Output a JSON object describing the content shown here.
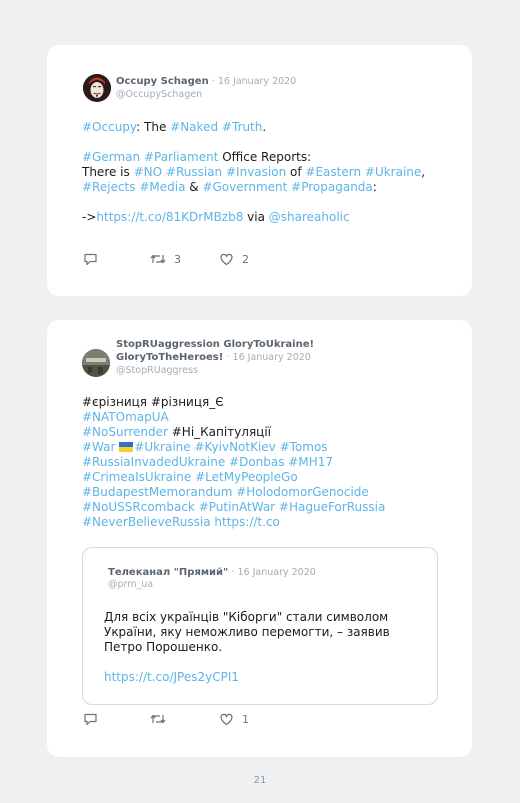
{
  "tweet1": {
    "display_name": "Occupy Schagen",
    "date": "· 16 January 2020",
    "handle": "@OccupySchagen",
    "line1": {
      "t1": "#Occupy",
      "t2": ": The ",
      "t3": "#Naked",
      "t4": " ",
      "t5": "#Truth",
      "t6": "."
    },
    "line2": {
      "t1": "#German",
      "t2": " ",
      "t3": "#Parliament",
      "t4": " Office Reports:"
    },
    "line3": {
      "t1": "There is ",
      "t2": "#NO",
      "t3": " ",
      "t4": "#Russian",
      "t5": " ",
      "t6": "#Invasion",
      "t7": " of ",
      "t8": "#Eastern",
      "t9": " ",
      "t10": "#Ukraine",
      "t11": ","
    },
    "line4": {
      "t1": "#Rejects",
      "t2": " ",
      "t3": "#Media",
      "t4": " & ",
      "t5": "#Government",
      "t6": " ",
      "t7": "#Propaganda",
      "t8": ":"
    },
    "line5": {
      "t1": "->",
      "t2": "https://t.co/81KDrMBzb8",
      "t3": " via ",
      "t4": "@shareaholic"
    },
    "retweets": "3",
    "likes": "2"
  },
  "tweet2": {
    "display_name_line1": "StopRUaggression GloryToUkraine!",
    "display_name_line2": "GloryToTheHeroes!",
    "date": "· 16 January 2020",
    "handle": "@StopRUaggress",
    "lines": {
      "l1": "#єрізниця #різниця_Є",
      "l2": "#NATOmapUA",
      "l3a": "#NoSurrender",
      "l3b": " #Ні_Капітуляції",
      "l4a": "#War ",
      "l4b": "#Ukraine #KyivNotKiev #Tomos",
      "l5": "#RussiaInvadedUkraine #Donbas #MH17",
      "l6": "#CrimeaIsUkraine #LetMyPeopleGo",
      "l7": "#BudapestMemorandum #HolodomorGenocide",
      "l8": "#NoUSSRcomback #PutinAtWar #HagueForRussia",
      "l9": "#NeverBelieveRussia https://t.co"
    },
    "quote": {
      "display_name": "Телеканал \"Прямий\"",
      "date": "· 16 January 2020",
      "handle": "@prm_ua",
      "text1": "Для всіх українців \"Кіборги\" стали символом",
      "text2": "України, яку неможливо перемогти, – заявив",
      "text3": "Петро Порошенко.",
      "link": "https://t.co/JPes2yCPI1"
    },
    "retweets": "",
    "likes": "1"
  },
  "page_number": "21",
  "colors": {
    "link": "#5eb4e8",
    "name": "#5a6570",
    "muted": "#a3adb6"
  }
}
